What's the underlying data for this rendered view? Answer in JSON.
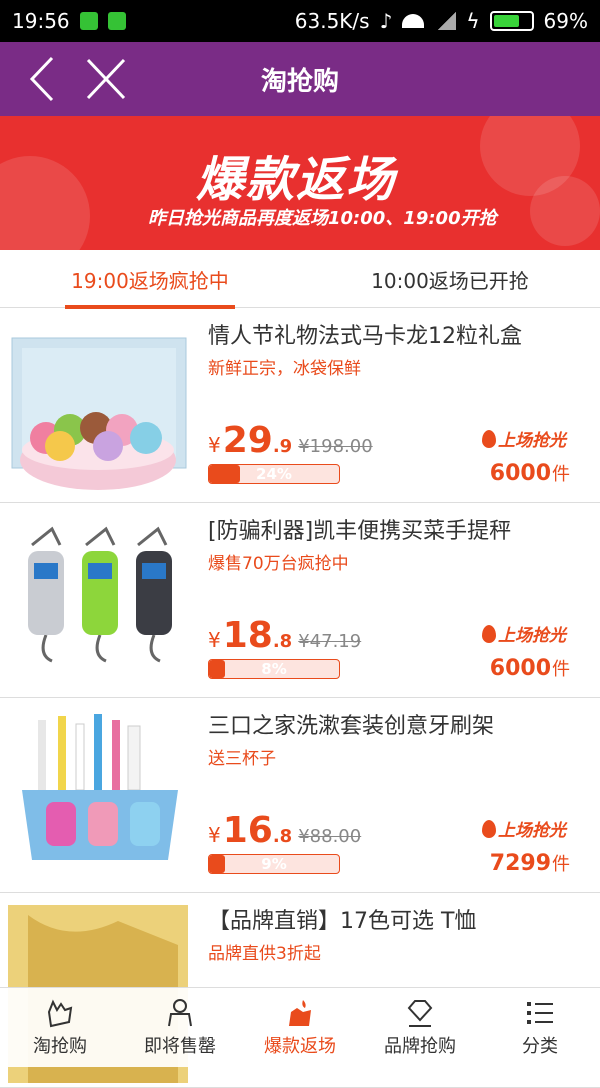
{
  "status_bar": {
    "time": "19:56",
    "net_speed": "63.5K/s",
    "battery": "69%"
  },
  "header": {
    "title": "淘抢购"
  },
  "banner": {
    "title": "爆款返场",
    "subtitle": "昨日抢光商品再度返场10:00、19:00开抢"
  },
  "tabs": [
    {
      "label": "19:00返场疯抢中",
      "active": true
    },
    {
      "label": "10:00返场已开抢",
      "active": false
    }
  ],
  "items": [
    {
      "title": "情人节礼物法式马卡龙12粒礼盒",
      "desc": "新鲜正宗，冰袋保鲜",
      "price_symbol": "¥",
      "price_int": "29",
      "price_dec": ".9",
      "original_price": "¥198.00",
      "progress_label": "24%",
      "progress": 0.24,
      "badge": "上场抢光",
      "sold": "6000",
      "unit": "件"
    },
    {
      "title": "[防骗利器]凯丰便携买菜手提秤",
      "desc": "爆售70万台疯抢中",
      "price_symbol": "¥",
      "price_int": "18",
      "price_dec": ".8",
      "original_price": "¥47.19",
      "progress_label": "8%",
      "progress": 0.08,
      "badge": "上场抢光",
      "sold": "6000",
      "unit": "件"
    },
    {
      "title": "三口之家洗漱套装创意牙刷架",
      "desc": "送三杯子",
      "price_symbol": "¥",
      "price_int": "16",
      "price_dec": ".8",
      "original_price": "¥88.00",
      "progress_label": "9%",
      "progress": 0.09,
      "badge": "上场抢光",
      "sold": "7299",
      "unit": "件"
    },
    {
      "title": "【品牌直销】17色可选 T恤",
      "desc": "品牌直供3折起"
    }
  ],
  "bottom_nav": [
    {
      "label": "淘抢购",
      "icon": "hand-icon",
      "active": false
    },
    {
      "label": "即将售罄",
      "icon": "clock-hand-icon",
      "active": false
    },
    {
      "label": "爆款返场",
      "icon": "fire-hand-icon",
      "active": true
    },
    {
      "label": "品牌抢购",
      "icon": "diamond-icon",
      "active": false
    },
    {
      "label": "分类",
      "icon": "list-icon",
      "active": false
    }
  ],
  "colors": {
    "header": "#7a2c86",
    "banner": "#e8302f",
    "accent": "#e94b1c"
  }
}
